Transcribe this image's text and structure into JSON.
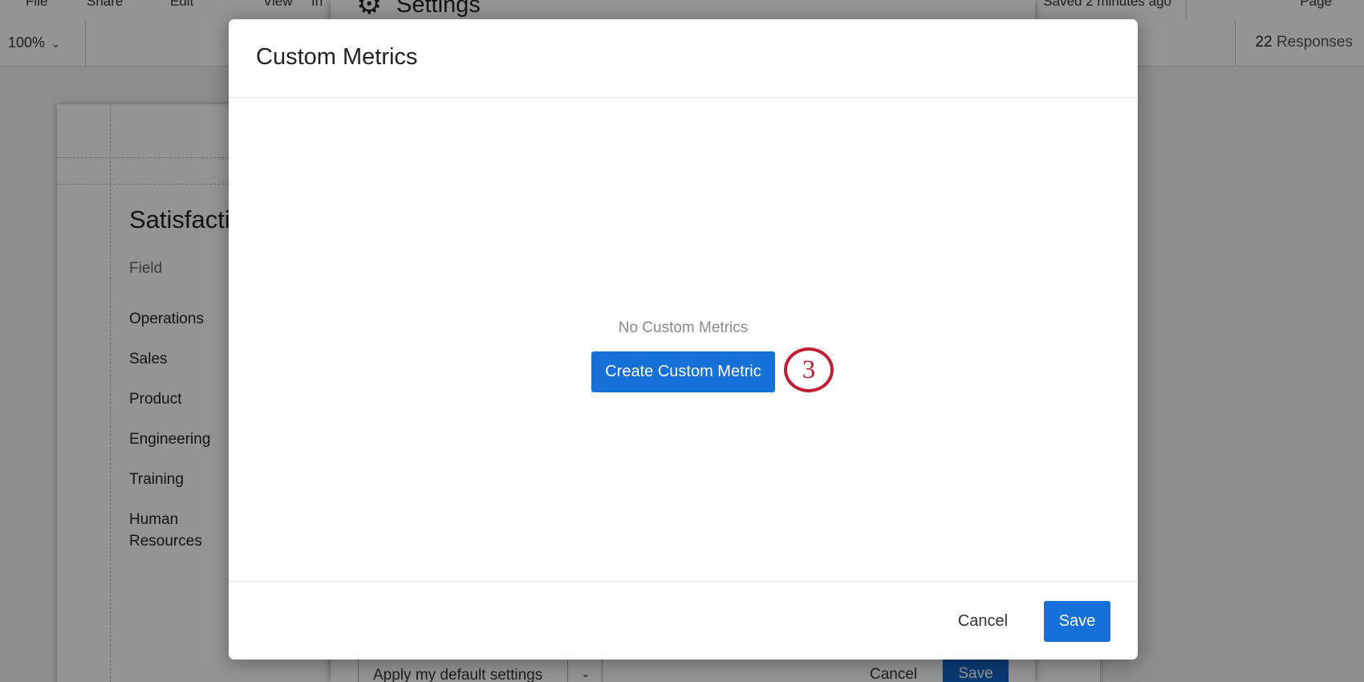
{
  "background": {
    "topbar": {
      "menu": [
        "File",
        "Share",
        "Edit",
        "View",
        "In"
      ],
      "saved_status": "Saved 2 minutes ago",
      "right_item": "Page"
    },
    "toolbar": {
      "zoom": "100%",
      "response_count": "22",
      "response_label": "Responses"
    },
    "report": {
      "title": "Satisfacti",
      "field_header": "Field",
      "rows": [
        "Operations",
        "Sales",
        "Product",
        "Engineering",
        "Training",
        "Human Resources"
      ]
    },
    "settings_panel": {
      "title": "Settings",
      "apply_defaults": "Apply my default settings",
      "cancel_label": "Cancel",
      "save_label": "Save"
    }
  },
  "modal": {
    "title": "Custom Metrics",
    "empty_text": "No Custom Metrics",
    "create_label": "Create Custom Metric",
    "step_marker": "3",
    "cancel_label": "Cancel",
    "save_label": "Save"
  },
  "colors": {
    "primary_blue": "#1571d7",
    "step_marker_red": "#c21f32"
  }
}
